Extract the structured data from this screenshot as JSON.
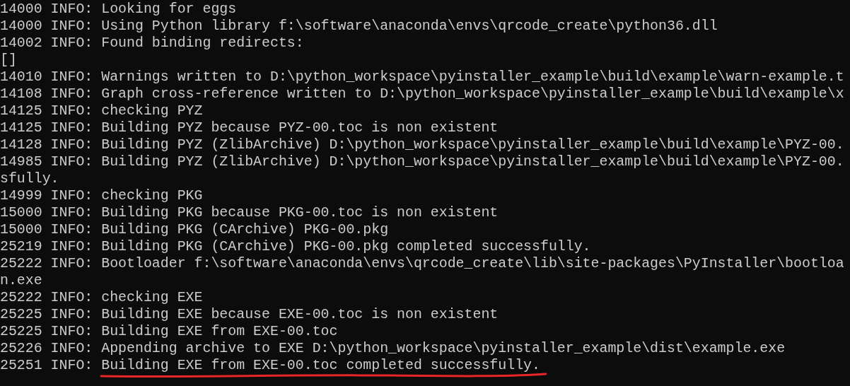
{
  "console": {
    "lines": [
      {
        "kind": "log",
        "prefix": "14000 INFO:",
        "message": "Looking for eggs",
        "underlined": false
      },
      {
        "kind": "log",
        "prefix": "14000 INFO:",
        "message": "Using Python library f:\\software\\anaconda\\envs\\qrcode_create\\python36.dll",
        "underlined": false
      },
      {
        "kind": "log",
        "prefix": "14002 INFO:",
        "message": "Found binding redirects:",
        "underlined": false
      },
      {
        "kind": "wrap",
        "message": "[]"
      },
      {
        "kind": "log",
        "prefix": "14010 INFO:",
        "message": "Warnings written to D:\\python_workspace\\pyinstaller_example\\build\\example\\warn-example.t",
        "underlined": false
      },
      {
        "kind": "log",
        "prefix": "14108 INFO:",
        "message": "Graph cross-reference written to D:\\python_workspace\\pyinstaller_example\\build\\example\\x",
        "underlined": false
      },
      {
        "kind": "log",
        "prefix": "14125 INFO:",
        "message": "checking PYZ",
        "underlined": false
      },
      {
        "kind": "log",
        "prefix": "14125 INFO:",
        "message": "Building PYZ because PYZ-00.toc is non existent",
        "underlined": false
      },
      {
        "kind": "log",
        "prefix": "14128 INFO:",
        "message": "Building PYZ (ZlibArchive) D:\\python_workspace\\pyinstaller_example\\build\\example\\PYZ-00.",
        "underlined": false
      },
      {
        "kind": "log",
        "prefix": "14985 INFO:",
        "message": "Building PYZ (ZlibArchive) D:\\python_workspace\\pyinstaller_example\\build\\example\\PYZ-00.",
        "underlined": false
      },
      {
        "kind": "wrap",
        "message": "sfully."
      },
      {
        "kind": "log",
        "prefix": "14999 INFO:",
        "message": "checking PKG",
        "underlined": false
      },
      {
        "kind": "log",
        "prefix": "15000 INFO:",
        "message": "Building PKG because PKG-00.toc is non existent",
        "underlined": false
      },
      {
        "kind": "log",
        "prefix": "15000 INFO:",
        "message": "Building PKG (CArchive) PKG-00.pkg",
        "underlined": false
      },
      {
        "kind": "log",
        "prefix": "25219 INFO:",
        "message": "Building PKG (CArchive) PKG-00.pkg completed successfully.",
        "underlined": false
      },
      {
        "kind": "log",
        "prefix": "25222 INFO:",
        "message": "Bootloader f:\\software\\anaconda\\envs\\qrcode_create\\lib\\site-packages\\PyInstaller\\bootloa",
        "underlined": false
      },
      {
        "kind": "wrap",
        "message": "n.exe"
      },
      {
        "kind": "log",
        "prefix": "25222 INFO:",
        "message": "checking EXE",
        "underlined": false
      },
      {
        "kind": "log",
        "prefix": "25225 INFO:",
        "message": "Building EXE because EXE-00.toc is non existent",
        "underlined": false
      },
      {
        "kind": "log",
        "prefix": "25225 INFO:",
        "message": "Building EXE from EXE-00.toc",
        "underlined": false
      },
      {
        "kind": "log",
        "prefix": "25226 INFO:",
        "message": "Appending archive to EXE D:\\python_workspace\\pyinstaller_example\\dist\\example.exe",
        "underlined": false
      },
      {
        "kind": "log",
        "prefix": "25251 INFO:",
        "message": "Building EXE from EXE-00.toc completed successfully.",
        "underlined": true
      }
    ]
  }
}
